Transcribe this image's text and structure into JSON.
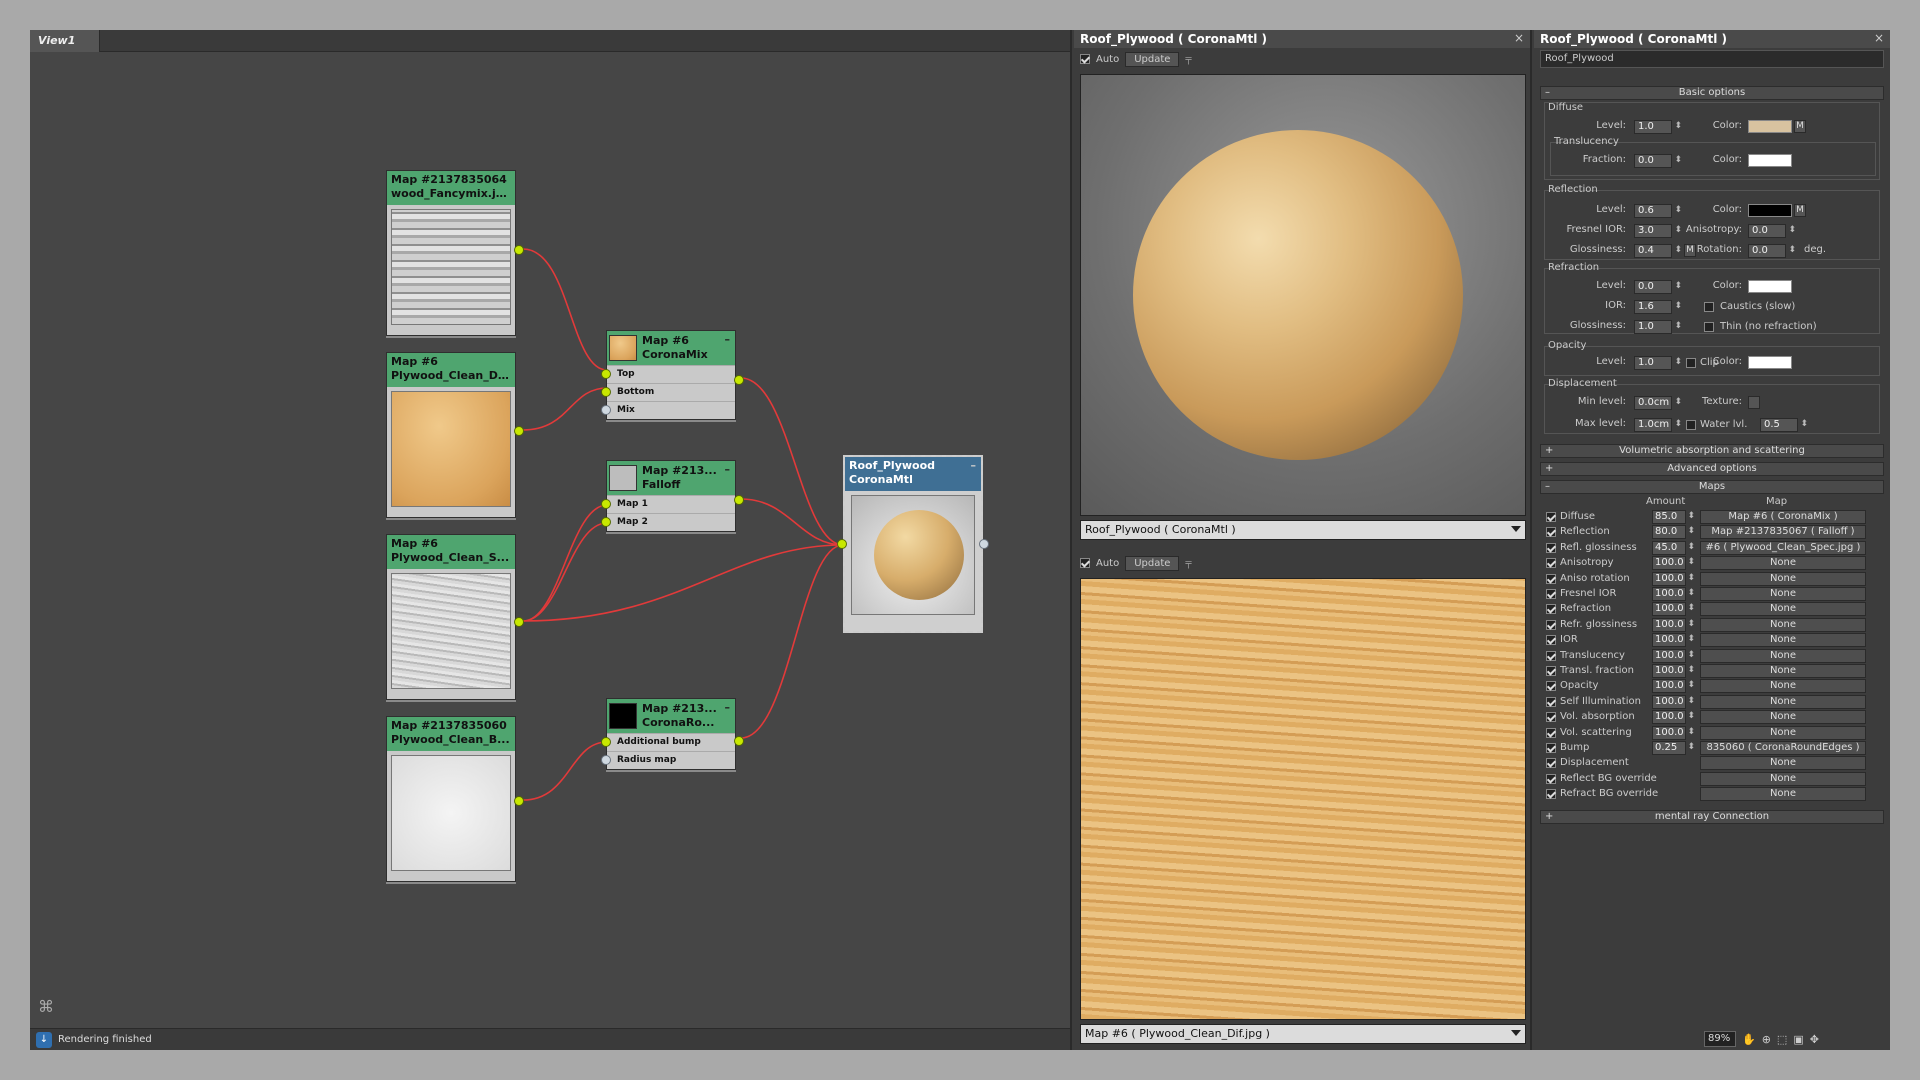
{
  "graph": {
    "view_tab": "View1",
    "status_text": "Rendering finished",
    "nodes": {
      "bitmap_wood": {
        "line1": "Map #2137835064",
        "line2": "wood_Fancymix.jpg"
      },
      "bitmap_dif": {
        "line1": "Map #6",
        "line2": "Plywood_Clean_Di..."
      },
      "bitmap_spec": {
        "line1": "Map #6",
        "line2": "Plywood_Clean_S..."
      },
      "bitmap_bump": {
        "line1": "Map #2137835060",
        "line2": "Plywood_Clean_B..."
      },
      "mix": {
        "line1": "Map #6",
        "line2": "CoronaMix",
        "slots": [
          "Top",
          "Bottom",
          "Mix"
        ]
      },
      "falloff": {
        "line1": "Map #213...",
        "line2": "Falloff",
        "slots": [
          "Map 1",
          "Map 2"
        ]
      },
      "roundedges": {
        "line1": "Map #213...",
        "line2": "CoronaRo...",
        "slots": [
          "Additional bump",
          "Radius map"
        ]
      },
      "material": {
        "line1": "Roof_Plywood",
        "line2": "CoronaMtl"
      }
    }
  },
  "preview": {
    "title": "Roof_Plywood  ( CoronaMtl )",
    "auto_label": "Auto",
    "update_label": "Update",
    "top_combo": "Roof_Plywood  ( CoronaMtl )",
    "bottom_combo": "Map #6  ( Plywood_Clean_Dif.jpg )"
  },
  "material_editor": {
    "title": "Roof_Plywood  ( CoronaMtl )",
    "name": "Roof_Plywood",
    "basic_options": "Basic options",
    "diffuse": {
      "group": "Diffuse",
      "level_label": "Level:",
      "level": "1.0",
      "color_label": "Color:",
      "color": "#d8c3a0"
    },
    "translucency": {
      "group": "Translucency",
      "fraction_label": "Fraction:",
      "fraction": "0.0",
      "color_label": "Color:",
      "color": "#ffffff"
    },
    "reflection": {
      "group": "Reflection",
      "level_label": "Level:",
      "level": "0.6",
      "color_label": "Color:",
      "color": "#000000",
      "fresnel_label": "Fresnel IOR:",
      "fresnel": "3.0",
      "aniso_label": "Anisotropy:",
      "aniso": "0.0",
      "gloss_label": "Glossiness:",
      "gloss": "0.4",
      "rot_label": "Rotation:",
      "rot": "0.0",
      "deg": "deg."
    },
    "refraction": {
      "group": "Refraction",
      "level_label": "Level:",
      "level": "0.0",
      "color_label": "Color:",
      "color": "#ffffff",
      "ior_label": "IOR:",
      "ior": "1.6",
      "caustics": "Caustics (slow)",
      "gloss_label": "Glossiness:",
      "gloss": "1.0",
      "thin": "Thin (no refraction)"
    },
    "opacity": {
      "group": "Opacity",
      "level_label": "Level:",
      "level": "1.0",
      "clip": "Clip",
      "color_label": "Color:",
      "color": "#ffffff"
    },
    "displacement": {
      "group": "Displacement",
      "min_label": "Min level:",
      "min": "0.0cm",
      "texture_label": "Texture:",
      "max_label": "Max level:",
      "max": "1.0cm",
      "water_label": "Water lvl.",
      "water": "0.5"
    },
    "volumetric": "Volumetric absorption and scattering",
    "advanced": "Advanced options",
    "maps_title": "Maps",
    "maps_amount_header": "Amount",
    "maps_map_header": "Map",
    "maps": [
      {
        "name": "Diffuse",
        "amount": "85.0",
        "map": "Map #6  ( CoronaMix )"
      },
      {
        "name": "Reflection",
        "amount": "80.0",
        "map": "Map #2137835067  ( Falloff )"
      },
      {
        "name": "Refl. glossiness",
        "amount": "45.0",
        "map": "#6  ( Plywood_Clean_Spec.jpg )"
      },
      {
        "name": "Anisotropy",
        "amount": "100.0",
        "map": "None"
      },
      {
        "name": "Aniso rotation",
        "amount": "100.0",
        "map": "None"
      },
      {
        "name": "Fresnel IOR",
        "amount": "100.0",
        "map": "None"
      },
      {
        "name": "Refraction",
        "amount": "100.0",
        "map": "None"
      },
      {
        "name": "Refr. glossiness",
        "amount": "100.0",
        "map": "None"
      },
      {
        "name": "IOR",
        "amount": "100.0",
        "map": "None"
      },
      {
        "name": "Translucency",
        "amount": "100.0",
        "map": "None"
      },
      {
        "name": "Transl. fraction",
        "amount": "100.0",
        "map": "None"
      },
      {
        "name": "Opacity",
        "amount": "100.0",
        "map": "None"
      },
      {
        "name": "Self Illumination",
        "amount": "100.0",
        "map": "None"
      },
      {
        "name": "Vol. absorption",
        "amount": "100.0",
        "map": "None"
      },
      {
        "name": "Vol. scattering",
        "amount": "100.0",
        "map": "None"
      },
      {
        "name": "Bump",
        "amount": "0.25",
        "map": "835060  ( CoronaRoundEdges )"
      },
      {
        "name": "Displacement",
        "amount": "",
        "map": "None"
      },
      {
        "name": "Reflect BG override",
        "amount": "",
        "map": "None"
      },
      {
        "name": "Refract BG override",
        "amount": "",
        "map": "None"
      }
    ],
    "mental_ray": "mental ray Connection",
    "zoom": "89%"
  }
}
